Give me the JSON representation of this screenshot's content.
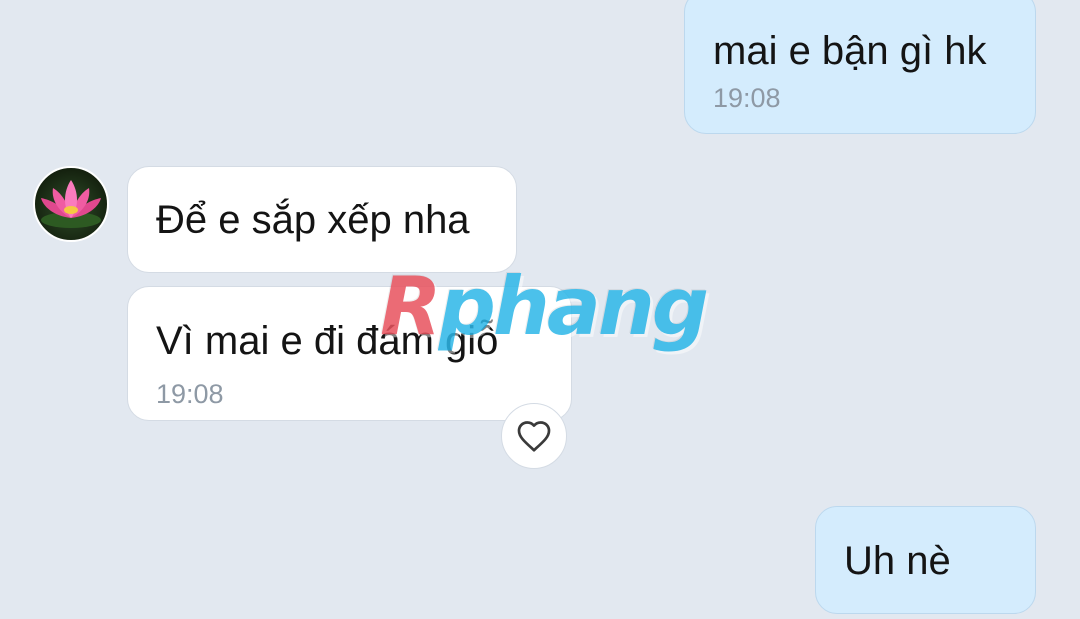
{
  "messages": [
    {
      "id": "m1",
      "direction": "sent",
      "text": "mai e bận gì hk",
      "time": "19:08"
    },
    {
      "id": "m2",
      "direction": "received",
      "text": "Để e sắp xếp nha",
      "time": ""
    },
    {
      "id": "m3",
      "direction": "received",
      "text": "Vì mai e đi đám giỗ",
      "time": "19:08"
    },
    {
      "id": "m4",
      "direction": "sent",
      "text": "Uh nè",
      "time": ""
    }
  ],
  "avatar": {
    "icon": "lotus-flower-icon"
  },
  "reaction": {
    "icon": "heart-outline-icon"
  },
  "watermark": {
    "first": "R",
    "rest": "phang"
  },
  "colors": {
    "background": "#e2e8f0",
    "sent_bubble": "#d4ecfd",
    "received_bubble": "#ffffff",
    "timestamp": "#8e99a5",
    "watermark_red": "#e8525d",
    "watermark_blue": "#2cb7e8"
  }
}
